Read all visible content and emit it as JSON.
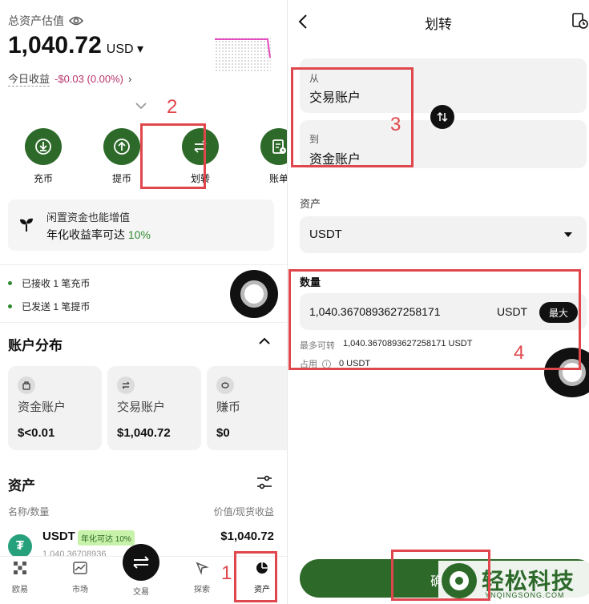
{
  "left": {
    "total_label": "总资产估值",
    "total_value": "1,040.72",
    "currency": "USD",
    "today_label": "今日收益",
    "today_value": "-$0.03 (0.00%)",
    "actions": [
      {
        "label": "充币",
        "icon": "deposit-icon"
      },
      {
        "label": "提币",
        "icon": "withdraw-icon"
      },
      {
        "label": "划转",
        "icon": "transfer-icon"
      },
      {
        "label": "账单",
        "icon": "bill-icon"
      }
    ],
    "promo_title": "闲置资金也能增值",
    "promo_text": "年化收益率可达",
    "promo_rate": "10%",
    "notices": [
      "已接收 1 笔充币",
      "已发送 1 笔提币"
    ],
    "dist_title": "账户分布",
    "accounts": [
      {
        "name": "资金账户",
        "value": "$<0.01"
      },
      {
        "name": "交易账户",
        "value": "$1,040.72"
      },
      {
        "name": "赚币",
        "value": "$0"
      }
    ],
    "assets_title": "资产",
    "col_left": "名称/数量",
    "col_right": "价值/现货收益",
    "asset": {
      "symbol": "USDT",
      "badge": "年化可达 10%",
      "value": "$1,040.72",
      "qty": "1,040.36708936"
    },
    "nav": [
      "欧易",
      "市场",
      "交易",
      "探索",
      "资产"
    ]
  },
  "right": {
    "title": "划转",
    "from_label": "从",
    "from_value": "交易账户",
    "to_label": "到",
    "to_value": "资金账户",
    "asset_label": "资产",
    "asset_value": "USDT",
    "qty_label": "数量",
    "qty_value": "1,040.3670893627258171",
    "qty_unit": "USDT",
    "max_label": "最大",
    "max_transfer_label": "最多可转",
    "max_transfer_value": "1,040.3670893627258171 USDT",
    "used_label": "占用",
    "used_value": "0 USDT",
    "confirm_label": "确"
  },
  "annotations": [
    "1",
    "2",
    "3",
    "4"
  ],
  "watermark": {
    "name": "轻松科技",
    "domain": "YNQINGSONG.COM"
  },
  "colors": {
    "accent": "#2d6a2a",
    "annotation": "#e0474c",
    "negative": "#b8336a",
    "promo_green": "#2f8a2f"
  }
}
